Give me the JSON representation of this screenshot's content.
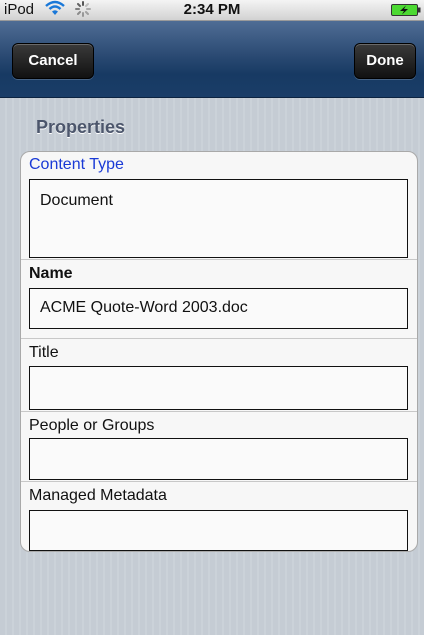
{
  "status_bar": {
    "carrier": "iPod",
    "time": "2:34 PM",
    "wifi_icon": "wifi-icon",
    "activity_icon": "activity-spinner-icon",
    "battery_icon": "battery-charging-icon"
  },
  "nav_bar": {
    "cancel_label": "Cancel",
    "done_label": "Done"
  },
  "section": {
    "title": "Properties"
  },
  "fields": [
    {
      "label": "Content Type",
      "value": "Document",
      "placeholder": ""
    },
    {
      "label": "Name",
      "value": "ACME Quote-Word 2003.doc",
      "placeholder": ""
    },
    {
      "label": "Title",
      "value": "",
      "placeholder": ""
    },
    {
      "label": "People or Groups",
      "value": "",
      "placeholder": ""
    },
    {
      "label": "Managed Metadata",
      "value": "",
      "placeholder": ""
    }
  ],
  "colors": {
    "nav_bar": "#1f416b",
    "content_type_label": "#1a3ad6",
    "section_header": "#4c566c",
    "background": "#c5ccd4",
    "battery_charge": "#4cd932"
  }
}
